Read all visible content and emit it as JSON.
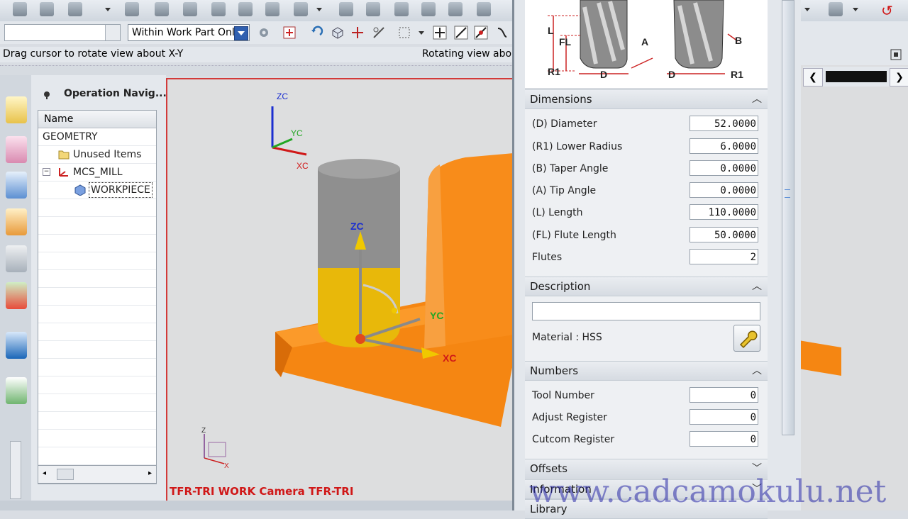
{
  "toolbar": {
    "filter_combo_value": "",
    "scope_combo_value": "Within Work Part Onl"
  },
  "status": {
    "left_message": "Drag cursor to rotate view about X-Y",
    "right_message": "Rotating view abo"
  },
  "navigator": {
    "title": "Operation Navig...",
    "column_name": "Name",
    "rows": [
      {
        "label": "GEOMETRY"
      },
      {
        "label": "Unused Items"
      },
      {
        "label": "MCS_MILL"
      },
      {
        "label": "WORKPIECE"
      }
    ]
  },
  "viewport": {
    "label": "TFR-TRI WORK Camera TFR-TRI",
    "triad_top": {
      "z": "ZC",
      "y": "YC",
      "x": "XC"
    },
    "triad_mid": {
      "z": "ZC",
      "y": "YC",
      "x": "XC"
    },
    "triad_bottom": {
      "z": "Z",
      "x": "X"
    }
  },
  "tool_diagram": {
    "labels": [
      "L",
      "FL",
      "R1",
      "D",
      "A",
      "B",
      "D",
      "R1"
    ]
  },
  "dialog": {
    "dimensions": {
      "title": "Dimensions",
      "fields": [
        {
          "label": "(D) Diameter",
          "value": "52.0000"
        },
        {
          "label": "(R1) Lower Radius",
          "value": "6.0000"
        },
        {
          "label": "(B) Taper Angle",
          "value": "0.0000"
        },
        {
          "label": "(A) Tip Angle",
          "value": "0.0000"
        },
        {
          "label": "(L) Length",
          "value": "110.0000"
        },
        {
          "label": "(FL) Flute Length",
          "value": "50.0000"
        },
        {
          "label": "Flutes",
          "value": "2"
        }
      ]
    },
    "description": {
      "title": "Description",
      "value": "",
      "material": "Material : HSS"
    },
    "numbers": {
      "title": "Numbers",
      "fields": [
        {
          "label": "Tool Number",
          "value": "0"
        },
        {
          "label": "Adjust Register",
          "value": "0"
        },
        {
          "label": "Cutcom Register",
          "value": "0"
        }
      ]
    },
    "offsets_title": "Offsets",
    "information_title": "Information",
    "library_title": "Library"
  },
  "watermark": "www.cadcamokulu.net"
}
